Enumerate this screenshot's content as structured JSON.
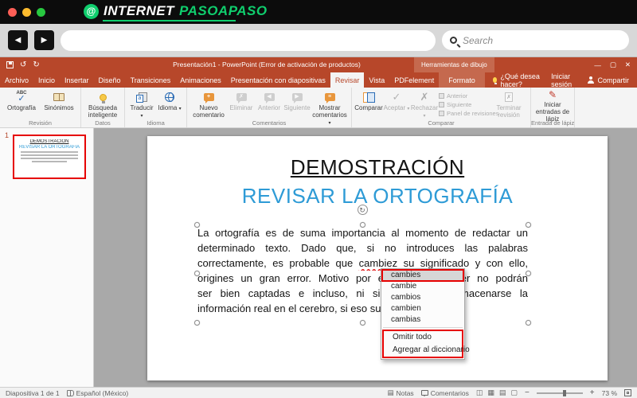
{
  "colors": {
    "ppt_red": "#B7472A",
    "context_tab_red": "#C5694E",
    "accent_blue": "#2E9BD6",
    "annotation_red": "#E60000",
    "logo_green": "#0FCE6D"
  },
  "icons": {
    "at": "@",
    "back": "◀",
    "forward": "▶",
    "check": "✓",
    "cross": "✗",
    "pen": "✎",
    "chevron_down": "▾",
    "plus": "+",
    "lines": "≡",
    "undo": "↺",
    "redo": "↻",
    "minimize": "—",
    "restore": "▢",
    "close": "✕",
    "rotate": "↻",
    "notes": "▤"
  },
  "site_header": {
    "logo_white": "INTERNET",
    "logo_green_text": "PASOAPASO",
    "search_placeholder": "Search"
  },
  "titlebar": {
    "title": "Presentación1 - PowerPoint (Error de activación de productos)",
    "context_group": "Herramientas de dibujo"
  },
  "tabs": {
    "file": "Archivo",
    "items": [
      "Inicio",
      "Insertar",
      "Diseño",
      "Transiciones",
      "Animaciones",
      "Presentación con diapositivas",
      "Revisar",
      "Vista",
      "PDFelement"
    ],
    "context_tab": "Formato",
    "tell_me": "¿Qué desea hacer?",
    "sign_in": "Iniciar sesión",
    "share": "Compartir"
  },
  "ribbon": {
    "revision": {
      "label": "Revisión",
      "abc": "ABC",
      "ortografia": "Ortografía",
      "sinonimos": "Sinónimos"
    },
    "datos": {
      "label": "Datos",
      "busqueda": "Búsqueda inteligente"
    },
    "idioma": {
      "label": "Idioma",
      "traducir": "Traducir",
      "idioma": "Idioma"
    },
    "comentarios": {
      "label": "Comentarios",
      "nuevo": "Nuevo comentario",
      "eliminar": "Eliminar",
      "anterior": "Anterior",
      "siguiente": "Siguiente",
      "mostrar": "Mostrar comentarios"
    },
    "comparar": {
      "label": "Comparar",
      "comparar": "Comparar",
      "aceptar": "Aceptar",
      "rechazar": "Rechazar",
      "anterior": "Anterior",
      "siguiente": "Siguiente",
      "panel": "Panel de revisiones",
      "terminar": "Terminar revisión"
    },
    "lapiz": {
      "label": "Entrada de lápiz",
      "iniciar": "Iniciar entradas de lápiz"
    }
  },
  "slide_panel": {
    "slide_number": "1"
  },
  "slide": {
    "title": "DEMOSTRACIÓN",
    "subtitle": "REVISAR LA ORTOGRAFÍA",
    "body": {
      "line1": "La ortografía es de suma importancia al momento de redactar un",
      "line2": "determinado texto. Dado que, si no introduces las palabras",
      "line3_before": "correctamente, es probable que ",
      "line3_word": "cambiez",
      "line3_after": " su significado y con ello,",
      "line4": "origines un gran error. Motivo por el que al exponer no podrán",
      "line5": "ser bien captadas e incluso, ni siquiera podrá almacenarse la",
      "line6": "información real en el cerebro, si eso sucede."
    }
  },
  "spell_menu": {
    "suggestions": [
      "cambies",
      "cambie",
      "cambios",
      "cambien",
      "cambias"
    ],
    "omit_all": "Omitir todo",
    "add_to_dictionary": "Agregar al diccionario"
  },
  "statusbar": {
    "slide_info": "Diapositiva 1 de 1",
    "language": "Español (México)",
    "notes": "Notas",
    "comments": "Comentarios",
    "view_icons": [
      "◫",
      "▦",
      "▤",
      "▢"
    ],
    "zoom_out": "−",
    "zoom_in": "+",
    "zoom_percent": "73 %"
  }
}
